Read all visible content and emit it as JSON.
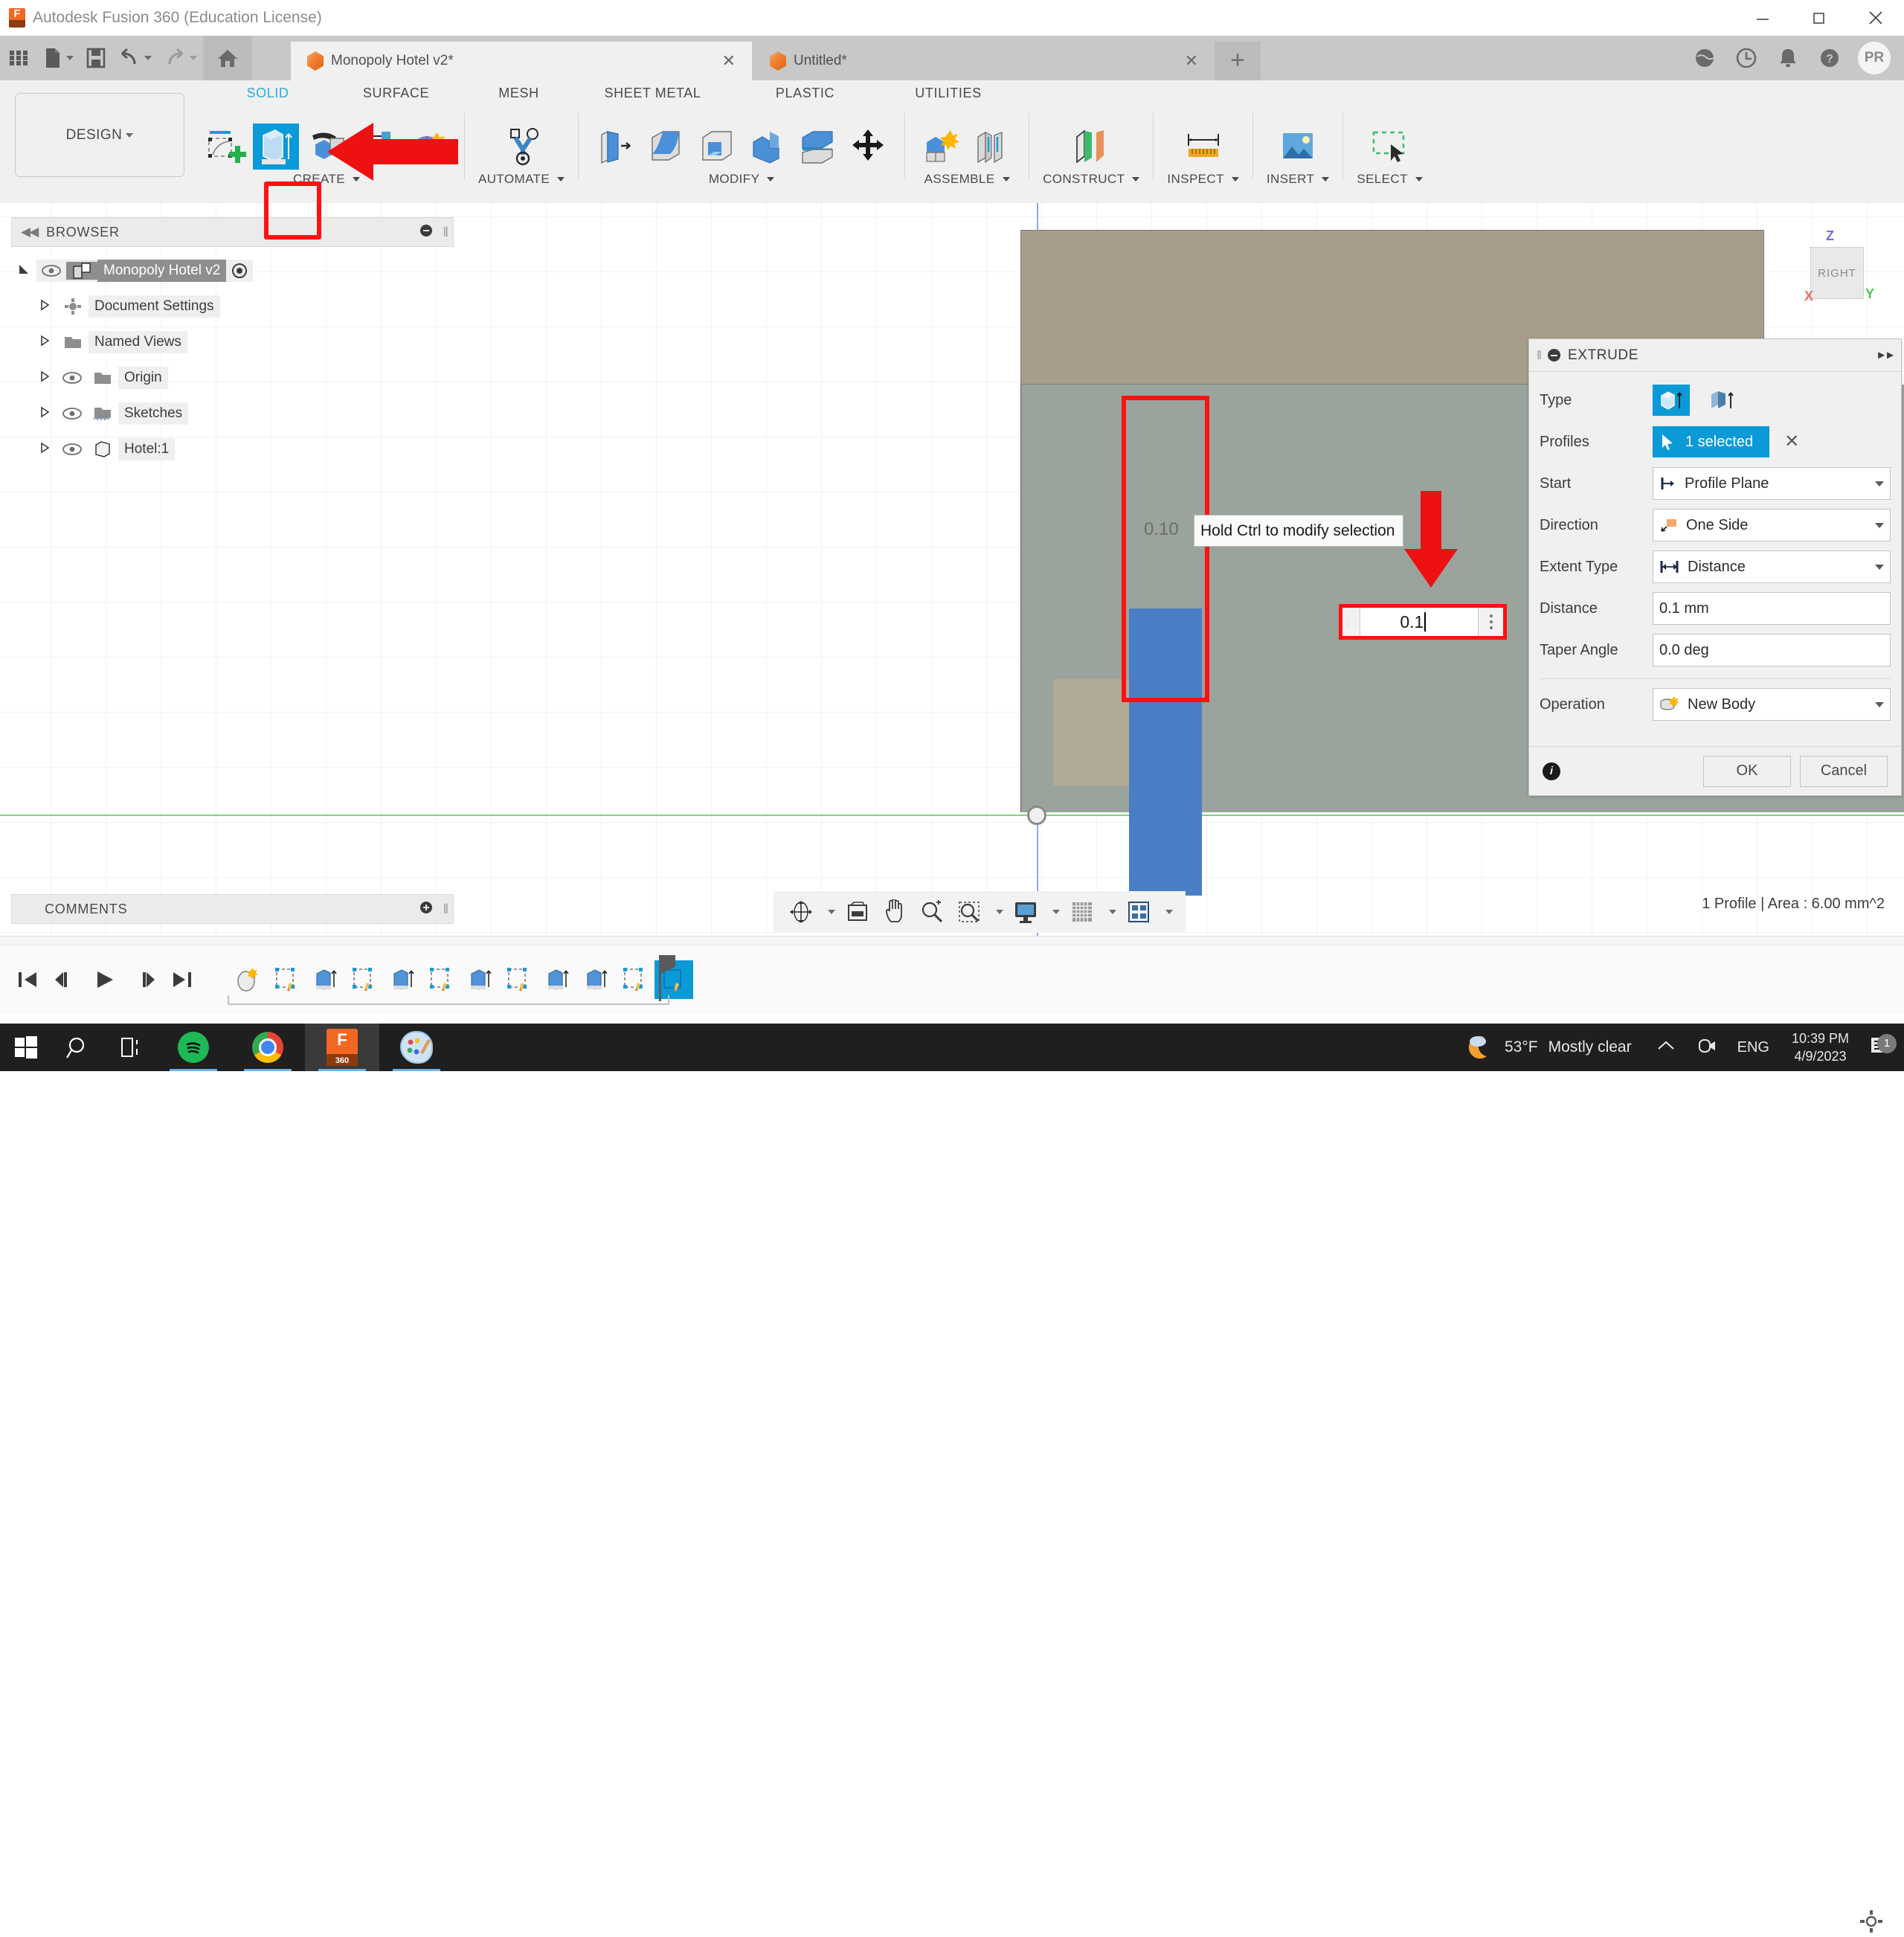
{
  "titlebar": {
    "app_title": "Autodesk Fusion 360 (Education License)",
    "app_icon": "fusion360-icon",
    "minimize": "minimize-icon",
    "maximize": "maximize-icon",
    "close": "close-icon"
  },
  "qat": {
    "grid_icon": "app-grid-icon",
    "new_icon": "new-file-icon",
    "save_icon": "save-icon",
    "undo_icon": "undo-icon",
    "redo_icon": "redo-icon",
    "home_icon": "home-icon",
    "tabs": [
      {
        "label": "Monopoly Hotel v2*",
        "active": true,
        "close": "close-icon"
      },
      {
        "label": "Untitled*",
        "active": false,
        "close": "close-icon"
      }
    ],
    "new_tab": "+",
    "right_icons": [
      "globe-icon",
      "recent-icon",
      "bell-icon",
      "help-icon"
    ],
    "avatar": "PR"
  },
  "ribbon": {
    "design_label": "DESIGN",
    "workspace_tabs": [
      {
        "label": "SOLID",
        "active": true
      },
      {
        "label": "SURFACE",
        "active": false
      },
      {
        "label": "MESH",
        "active": false
      },
      {
        "label": "SHEET METAL",
        "active": false
      },
      {
        "label": "PLASTIC",
        "active": false
      },
      {
        "label": "UTILITIES",
        "active": false
      }
    ],
    "groups": [
      {
        "label": "CREATE",
        "has_caret": true
      },
      {
        "label": "AUTOMATE",
        "has_caret": true
      },
      {
        "label": "MODIFY",
        "has_caret": true
      },
      {
        "label": "ASSEMBLE",
        "has_caret": true
      },
      {
        "label": "CONSTRUCT",
        "has_caret": true
      },
      {
        "label": "INSPECT",
        "has_caret": true
      },
      {
        "label": "INSERT",
        "has_caret": true
      },
      {
        "label": "SELECT",
        "has_caret": true
      }
    ],
    "highlight_color": "#ff1111",
    "accent_color": "#29abe2"
  },
  "browser": {
    "title": "BROWSER",
    "collapse_icon": "collapse-left-icon",
    "minimize_icon": "minimize-circle-icon",
    "items": [
      {
        "label": "Monopoly Hotel v2",
        "icon": "component-icon",
        "root": true,
        "eye": true,
        "radio": true
      },
      {
        "label": "Document Settings",
        "icon": "gear-icon",
        "eye": false
      },
      {
        "label": "Named Views",
        "icon": "folder-icon",
        "eye": false
      },
      {
        "label": "Origin",
        "icon": "folder-icon",
        "eye": true
      },
      {
        "label": "Sketches",
        "icon": "folder-sketch-icon",
        "eye": true
      },
      {
        "label": "Hotel:1",
        "icon": "body-icon",
        "eye": true
      }
    ]
  },
  "canvas": {
    "dimension_label": "0.10",
    "tooltip": "Hold Ctrl to modify selection",
    "dimension_input_value": "0.1",
    "viewcube_face": "RIGHT",
    "axis_z": "Z",
    "axis_y": "Y",
    "axis_x": "X"
  },
  "extrude": {
    "title": "EXTRUDE",
    "expand_icon": "expand-right-icon",
    "rows": [
      {
        "label": "Type",
        "kind": "typeicons",
        "selected": 0
      },
      {
        "label": "Profiles",
        "kind": "select",
        "value": "1 selected",
        "clear": "clear-icon"
      },
      {
        "label": "Start",
        "kind": "dropdown",
        "value": "Profile Plane",
        "icon": "profile-plane-icon"
      },
      {
        "label": "Direction",
        "kind": "dropdown",
        "value": "One Side",
        "icon": "one-side-icon"
      },
      {
        "label": "Extent Type",
        "kind": "dropdown",
        "value": "Distance",
        "icon": "distance-icon"
      },
      {
        "label": "Distance",
        "kind": "text",
        "value": "0.1 mm"
      },
      {
        "label": "Taper Angle",
        "kind": "text",
        "value": "0.0 deg"
      },
      {
        "label": "Operation",
        "kind": "dropdown",
        "value": "New Body",
        "icon": "new-body-icon"
      }
    ],
    "info_icon": "info-icon",
    "ok_label": "OK",
    "cancel_label": "Cancel"
  },
  "comments": {
    "title": "COMMENTS",
    "add_icon": "add-comment-icon"
  },
  "navbar": {
    "buttons": [
      "orbit-icon",
      "orbit-caret",
      "look-at-icon",
      "pan-icon",
      "zoom-icon",
      "zoom-window-icon",
      "zoom-window-caret",
      "display-settings-icon",
      "display-caret",
      "grid-snap-icon",
      "grid-caret",
      "viewports-icon",
      "viewports-caret"
    ]
  },
  "status": {
    "text": "1 Profile | Area : 6.00 mm^2"
  },
  "timeline": {
    "nav_buttons": [
      "go-to-start-icon",
      "step-back-icon",
      "play-icon",
      "step-forward-icon",
      "go-to-end-icon"
    ],
    "feature_count": 11,
    "selected_index": 10,
    "settings_icon": "gear-icon"
  },
  "taskbar": {
    "start": "windows-start-icon",
    "search": "search-icon",
    "task_view": "task-view-icon",
    "apps": [
      {
        "name": "spotify-icon",
        "running": true
      },
      {
        "name": "chrome-icon",
        "running": true
      },
      {
        "name": "fusion360-icon",
        "running": true,
        "active": true
      },
      {
        "name": "paint-icon",
        "running": true
      }
    ],
    "weather_icon": "moon-cloud-icon",
    "temperature": "53°F",
    "condition": "Mostly clear",
    "chevron": "show-hidden-icon",
    "camera_icon": "camera-icon",
    "language": "ENG",
    "time": "10:39 PM",
    "date": "4/9/2023",
    "notification_icon": "notification-icon",
    "notification_count": "1"
  }
}
